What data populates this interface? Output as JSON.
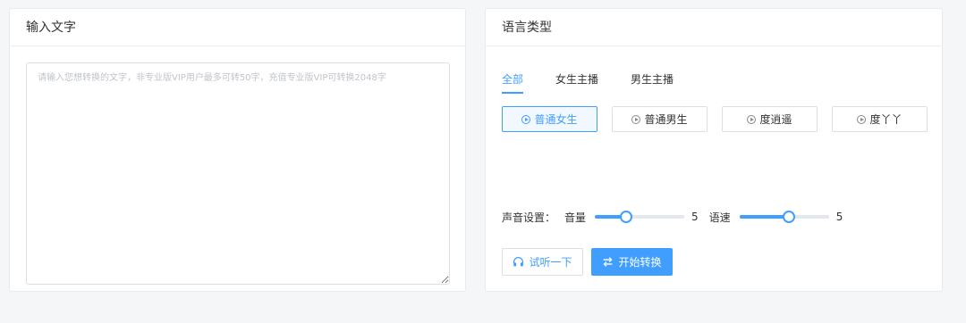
{
  "input_panel": {
    "title": "输入文字",
    "placeholder": "请输入您想转换的文字，非专业版VIP用户最多可转50字，充值专业版VIP可转换2048字",
    "value": ""
  },
  "voice_panel": {
    "title": "语言类型",
    "tabs": [
      {
        "label": "全部",
        "active": true
      },
      {
        "label": "女生主播",
        "active": false
      },
      {
        "label": "男生主播",
        "active": false
      }
    ],
    "voices": [
      {
        "label": "普通女生",
        "icon": "play-circle-icon",
        "selected": true
      },
      {
        "label": "普通男生",
        "icon": "play-circle-icon",
        "selected": false
      },
      {
        "label": "度逍遥",
        "icon": "play-circle-icon",
        "selected": false
      },
      {
        "label": "度丫丫",
        "icon": "play-circle-icon",
        "selected": false
      }
    ],
    "sound_settings": {
      "label": "声音设置：",
      "volume": {
        "label": "音量",
        "value": "5",
        "fraction": 0.35
      },
      "speed": {
        "label": "语速",
        "value": "5",
        "fraction": 0.55
      }
    },
    "buttons": {
      "listen": {
        "label": "试听一下",
        "icon": "headphones-icon"
      },
      "convert": {
        "label": "开始转换",
        "icon": "swap-arrows-icon"
      }
    }
  },
  "colors": {
    "accent": "#409eff",
    "background": "#f5f6f8",
    "border": "#dcdfe6"
  }
}
